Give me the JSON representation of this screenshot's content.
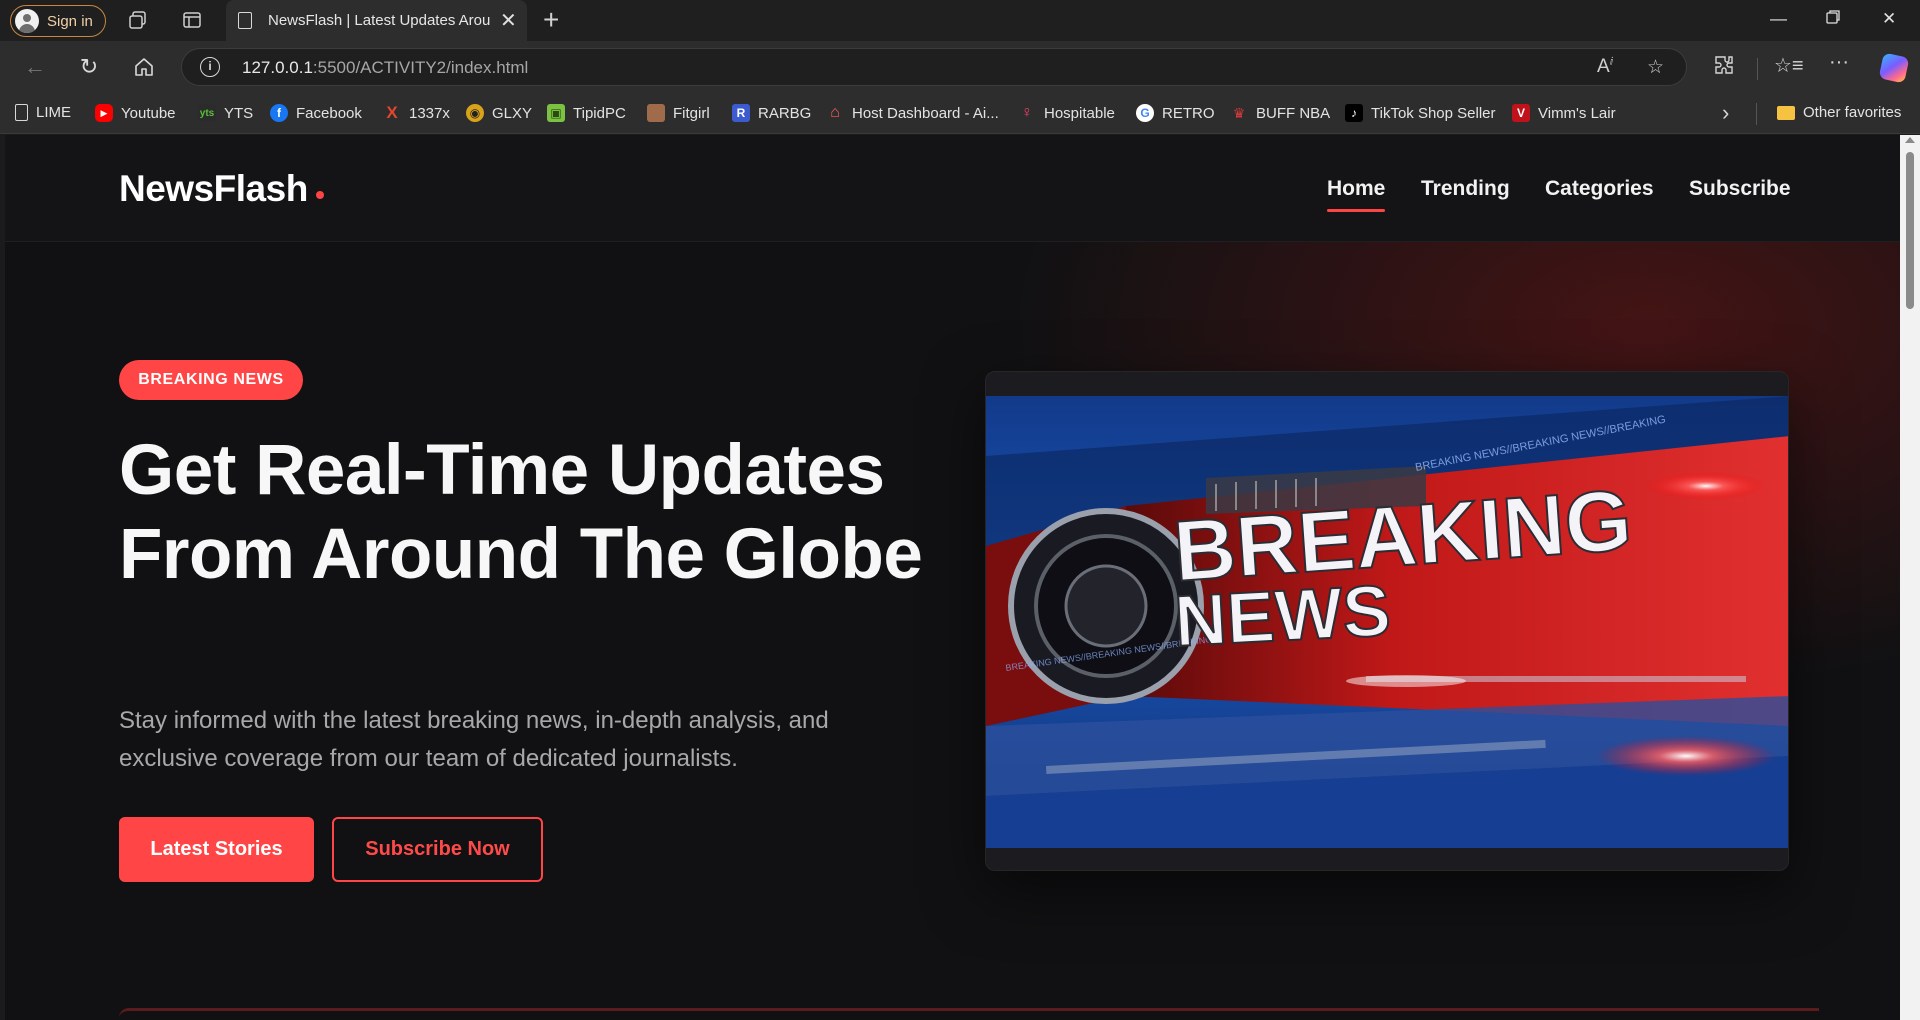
{
  "browser": {
    "signin_label": "Sign in",
    "tab_title": "NewsFlash | Latest Updates Around",
    "url_host": "127.0.0.1",
    "url_path": ":5500/ACTIVITY2/index.html"
  },
  "bookmarks": [
    {
      "label": "LIME",
      "icon": "document-icon",
      "color": "#d8d8d8"
    },
    {
      "label": "Youtube",
      "icon": "youtube-icon",
      "color": "#ff0000"
    },
    {
      "label": "YTS",
      "icon": "yts-icon",
      "color": "#3a8d2a"
    },
    {
      "label": "Facebook",
      "icon": "facebook-icon",
      "color": "#1877f2"
    },
    {
      "label": "1337x",
      "icon": "1337x-icon",
      "color": "#e2462c"
    },
    {
      "label": "GLXY",
      "icon": "glxy-icon",
      "color": "#d8a21a"
    },
    {
      "label": "TipidPC",
      "icon": "tipidpc-icon",
      "color": "#7cc242"
    },
    {
      "label": "Fitgirl",
      "icon": "fitgirl-icon",
      "color": "#a06b4a"
    },
    {
      "label": "RARBG",
      "icon": "rarbg-icon",
      "color": "#3b5bcf"
    },
    {
      "label": "Host Dashboard - Ai...",
      "icon": "airbnb-icon",
      "color": "#ff5a5f"
    },
    {
      "label": "Hospitable",
      "icon": "hospitable-icon",
      "color": "#f0416c"
    },
    {
      "label": "RETRO",
      "icon": "google-icon",
      "color": "#ffffff"
    },
    {
      "label": "BUFF NBA",
      "icon": "buff-nba-icon",
      "color": "#d63a3a"
    },
    {
      "label": "TikTok Shop Seller",
      "icon": "tiktok-icon",
      "color": "#000000"
    },
    {
      "label": "Vimm's Lair",
      "icon": "vimms-lair-icon",
      "color": "#c0121a"
    }
  ],
  "other_favorites": "Other favorites",
  "site": {
    "logo": "NewsFlash",
    "nav": [
      "Home",
      "Trending",
      "Categories",
      "Subscribe"
    ],
    "badge": "BREAKING NEWS",
    "headline": "Get Real-Time Updates From Around The Globe",
    "lede": "Stay informed with the latest breaking news, in-depth analysis, and exclusive coverage from our team of dedicated journalists.",
    "primary_cta": "Latest Stories",
    "secondary_cta": "Subscribe Now",
    "hero_image_text_1": "BREAKING",
    "hero_image_text_2": "NEWS",
    "hero_ticker_text": "BREAKING NEWS//BREAKING NEWS//BREAKING",
    "accent_color": "#ff4545"
  }
}
